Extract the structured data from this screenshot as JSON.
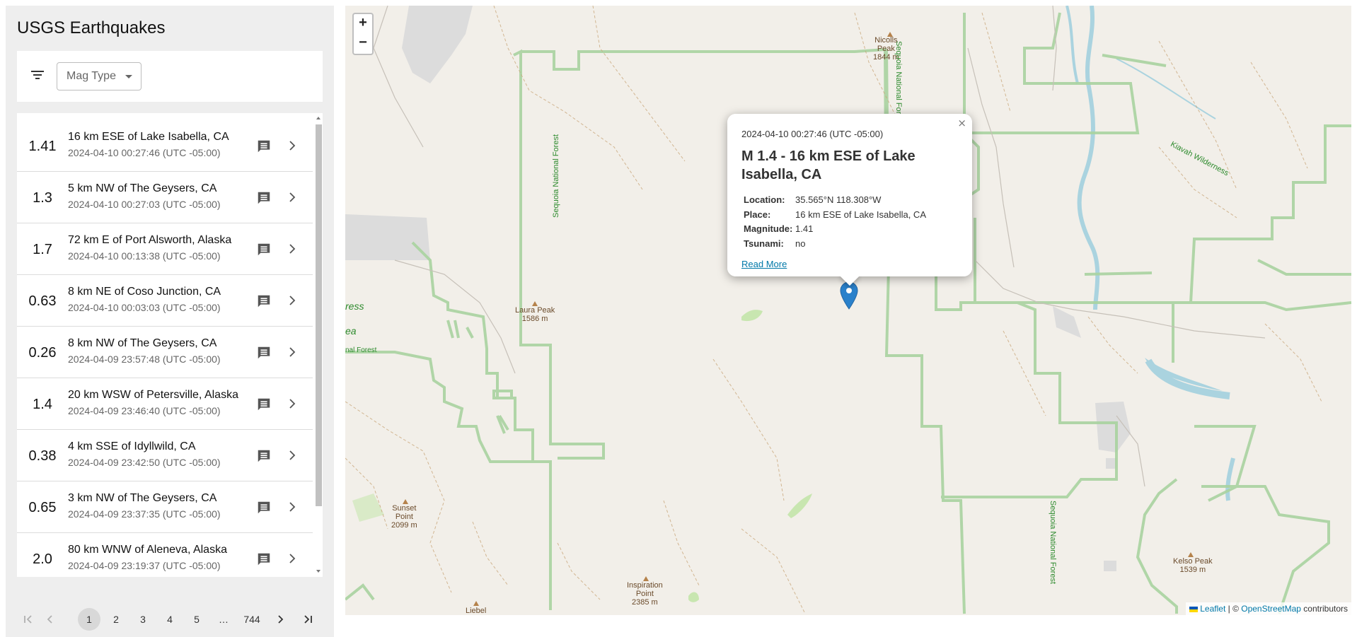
{
  "sidebar": {
    "title": "USGS Earthquakes",
    "filter_icon": "filter-list-icon",
    "mag_type_label": "Mag Type",
    "earthquakes": [
      {
        "mag": "1.41",
        "place": "16 km ESE of Lake Isabella, CA",
        "time": "2024-04-10 00:27:46 (UTC -05:00)"
      },
      {
        "mag": "1.3",
        "place": "5 km NW of The Geysers, CA",
        "time": "2024-04-10 00:27:03 (UTC -05:00)"
      },
      {
        "mag": "1.7",
        "place": "72 km E of Port Alsworth, Alaska",
        "time": "2024-04-10 00:13:38 (UTC -05:00)"
      },
      {
        "mag": "0.63",
        "place": "8 km NE of Coso Junction, CA",
        "time": "2024-04-10 00:03:03 (UTC -05:00)"
      },
      {
        "mag": "0.26",
        "place": "8 km NW of The Geysers, CA",
        "time": "2024-04-09 23:57:48 (UTC -05:00)"
      },
      {
        "mag": "1.4",
        "place": "20 km WSW of Petersville, Alaska",
        "time": "2024-04-09 23:46:40 (UTC -05:00)"
      },
      {
        "mag": "0.38",
        "place": "4 km SSE of Idyllwild, CA",
        "time": "2024-04-09 23:42:50 (UTC -05:00)"
      },
      {
        "mag": "0.65",
        "place": "3 km NW of The Geysers, CA",
        "time": "2024-04-09 23:37:35 (UTC -05:00)"
      },
      {
        "mag": "2.0",
        "place": "80 km WNW of Aleneva, Alaska",
        "time": "2024-04-09 23:19:37 (UTC -05:00)"
      }
    ],
    "row_icons": {
      "comment": "comment-icon",
      "chevron": "chevron-right-icon"
    }
  },
  "pagination": {
    "pages": [
      "1",
      "2",
      "3",
      "4",
      "5",
      "…",
      "744"
    ],
    "current": "1",
    "icons": [
      "first-page-icon",
      "previous-page-icon",
      "next-page-icon",
      "last-page-icon"
    ]
  },
  "map": {
    "zoom_in": "+",
    "zoom_out": "−",
    "labels": {
      "nicolls": "Nicolls\nPeak\n1844 m",
      "laura": "Laura Peak\n1586 m",
      "sunset": "Sunset\nPoint\n2099 m",
      "inspiration": "Inspiration\nPoint\n2385 m",
      "liebel": "Liebel",
      "kelso": "Kelso Peak\n1539 m",
      "kiavah": "Kiavah Wilderness",
      "sequoia_forest": "Sequoia National Forest",
      "wilderness_fragment_1": "ress",
      "wilderness_fragment_2": "ea",
      "national_forest_fragment": "nal Forest"
    },
    "attribution": {
      "leaflet": "Leaflet",
      "separator": " | © ",
      "osm": "OpenStreetMap",
      "suffix": " contributors"
    },
    "colors": {
      "background": "#f2efe9",
      "boundary": "#a9d3a0",
      "water": "#aad3df",
      "marker": "#2a81cb"
    }
  },
  "popup": {
    "time": "2024-04-10 00:27:46 (UTC -05:00)",
    "title": "M 1.4 - 16 km ESE of Lake Isabella, CA",
    "close": "×",
    "fields": [
      {
        "key": "Location:",
        "value": "35.565°N 118.308°W"
      },
      {
        "key": "Place:",
        "value": "16 km ESE of Lake Isabella, CA"
      },
      {
        "key": "Magnitude:",
        "value": "1.41"
      },
      {
        "key": "Tsunami:",
        "value": "no"
      }
    ],
    "link": "Read More"
  }
}
